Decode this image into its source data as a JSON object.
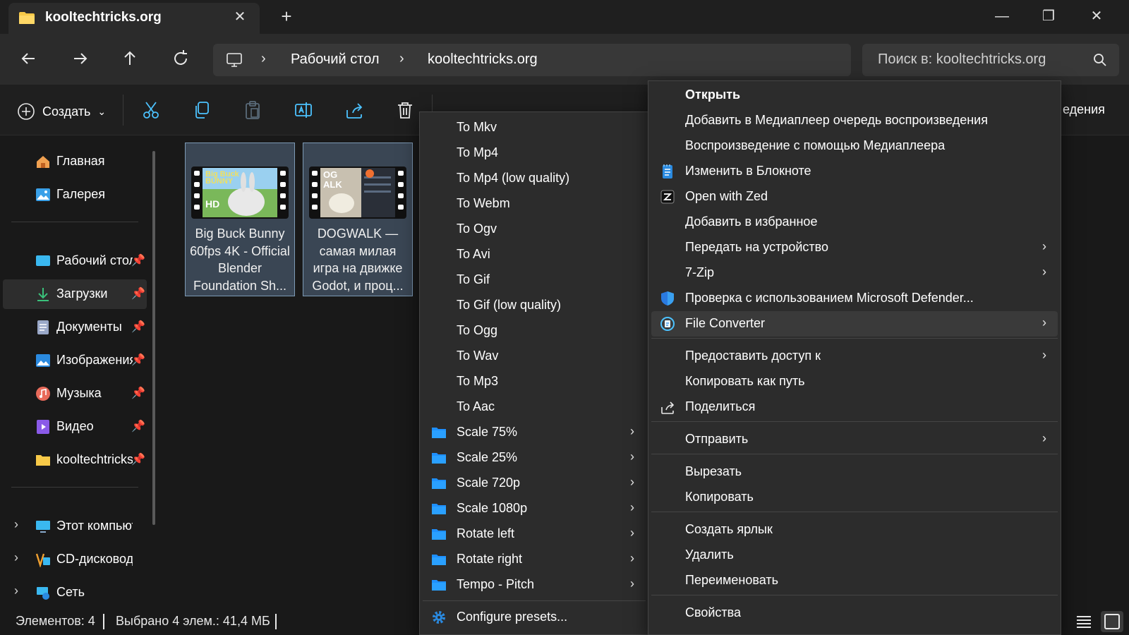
{
  "window": {
    "tab_title": "kooltechtricks.org",
    "new_tab_glyph": "+",
    "close_tab_glyph": "✕",
    "minimize_glyph": "—",
    "maximize_glyph": "❐",
    "close_glyph": "✕"
  },
  "address": {
    "breadcrumbs": [
      "Рабочий стол",
      "kooltechtricks.org"
    ],
    "separator": "›",
    "search_placeholder": "Поиск в: kooltechtricks.org"
  },
  "toolbar": {
    "create_label": "Создать",
    "create_chevron": "⌄",
    "details_label": "едения"
  },
  "sidebar": {
    "items": [
      {
        "label": "Главная",
        "icon": "home-icon",
        "pinned": false
      },
      {
        "label": "Галерея",
        "icon": "gallery-icon",
        "pinned": false
      },
      {
        "label": "Рабочий стол",
        "icon": "desktop-icon",
        "pinned": true
      },
      {
        "label": "Загрузки",
        "icon": "download-icon",
        "pinned": true,
        "active": true
      },
      {
        "label": "Документы",
        "icon": "documents-icon",
        "pinned": true
      },
      {
        "label": "Изображения",
        "icon": "pictures-icon",
        "pinned": true
      },
      {
        "label": "Музыка",
        "icon": "music-icon",
        "pinned": true
      },
      {
        "label": "Видео",
        "icon": "video-icon",
        "pinned": true
      },
      {
        "label": "kooltechtricks.org",
        "icon": "folder-icon",
        "pinned": true
      },
      {
        "label": "Этот компьютер",
        "icon": "computer-icon",
        "expandable": true
      },
      {
        "label": "CD-дисковод (D:)",
        "icon": "cd-drive-icon",
        "expandable": true
      },
      {
        "label": "Сеть",
        "icon": "network-icon",
        "expandable": true
      }
    ],
    "pin_glyph": "📌",
    "expand_glyph": "›"
  },
  "files": [
    {
      "name": "Big Buck Bunny 60fps 4K - Official Blender Foundation Sh...",
      "thumb_text": "Big Buck Bunny HD"
    },
    {
      "name": "DOGWALK — самая милая игра на движке Godot, и проц...",
      "thumb_text": "DOG WALK"
    }
  ],
  "status": {
    "items_count": "Элементов: 4",
    "selected": "Выбрано 4 элем.: 41,4 МБ"
  },
  "main_menu": {
    "items": [
      {
        "label": "Открыть",
        "bold": true
      },
      {
        "label": "Добавить в Медиаплеер очередь воспроизведения"
      },
      {
        "label": "Воспроизведение с помощью Медиаплеера"
      },
      {
        "label": "Изменить в Блокноте",
        "icon": "notepad-icon"
      },
      {
        "label": "Open with Zed",
        "icon": "zed-icon"
      },
      {
        "label": "Добавить в избранное"
      },
      {
        "label": "Передать на устройство",
        "submenu": true
      },
      {
        "label": "7-Zip",
        "submenu": true
      },
      {
        "label": "Проверка с использованием Microsoft Defender...",
        "icon": "defender-shield-icon"
      },
      {
        "label": "File Converter",
        "icon": "file-converter-icon",
        "submenu": true,
        "hover": true
      },
      {
        "label": "Предоставить доступ к",
        "submenu": true
      },
      {
        "label": "Копировать как путь"
      },
      {
        "label": "Поделиться",
        "icon": "share-icon"
      },
      {
        "label": "Отправить",
        "submenu": true
      },
      {
        "label": "Вырезать"
      },
      {
        "label": "Копировать"
      },
      {
        "label": "Создать ярлык"
      },
      {
        "label": "Удалить"
      },
      {
        "label": "Переименовать"
      },
      {
        "label": "Свойства"
      }
    ],
    "arrow_glyph": "›"
  },
  "converter_menu": {
    "items": [
      {
        "label": "To Mkv"
      },
      {
        "label": "To Mp4"
      },
      {
        "label": "To Mp4 (low quality)"
      },
      {
        "label": "To Webm"
      },
      {
        "label": "To Ogv"
      },
      {
        "label": "To Avi"
      },
      {
        "label": "To Gif"
      },
      {
        "label": "To Gif (low quality)"
      },
      {
        "label": "To Ogg"
      },
      {
        "label": "To Wav"
      },
      {
        "label": "To Mp3"
      },
      {
        "label": "To Aac"
      },
      {
        "label": "Scale 75%",
        "folder": true
      },
      {
        "label": "Scale 25%",
        "folder": true
      },
      {
        "label": "Scale 720p",
        "folder": true
      },
      {
        "label": "Scale 1080p",
        "folder": true
      },
      {
        "label": "Rotate left",
        "folder": true
      },
      {
        "label": "Rotate right",
        "folder": true
      },
      {
        "label": "Tempo - Pitch",
        "folder": true
      },
      {
        "label": "Configure presets...",
        "icon": "settings-gear-icon"
      }
    ]
  },
  "colors": {
    "accent": "#4cc2ff",
    "folder_yellow": "#f7c948",
    "folder_blue": "#1e90ff",
    "selection": "#3a4654"
  }
}
